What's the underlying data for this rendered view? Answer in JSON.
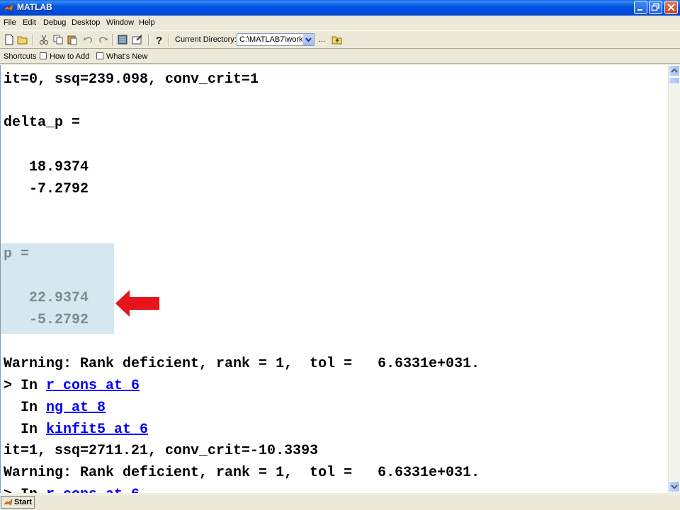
{
  "window": {
    "title": "MATLAB"
  },
  "menu": [
    "File",
    "Edit",
    "Debug",
    "Desktop",
    "Window",
    "Help"
  ],
  "toolbar": {
    "current_directory_label": "Current Directory:",
    "current_directory_value": "C:\\MATLAB7\\work",
    "browse_label": "..."
  },
  "shortcuts": {
    "label": "Shortcuts",
    "how_to_add": "How to Add",
    "whats_new": "What's New"
  },
  "console": {
    "lines": [
      "it=0, ssq=239.098, conv_crit=1",
      "delta_p =",
      "   18.9374",
      "   -7.2792",
      "p =",
      "   22.9374",
      "   -5.2792",
      "Warning: Rank deficient, rank = 1,  tol =   6.6331e+031.",
      "> In ",
      "  In ",
      "  In ",
      "it=1, ssq=2711.21, conv_crit=-10.3393",
      "Warning: Rank deficient, rank = 1,  tol =   6.6331e+031.",
      "> In "
    ],
    "links": [
      "r_cons at 6",
      "ng at 8",
      "kinfit5 at 6",
      "r_cons at 6"
    ]
  },
  "taskbar": {
    "start_label": "Start"
  },
  "colors": {
    "highlight": "#d6e8ef",
    "arrow": "#e8141c",
    "link": "#0000ff"
  }
}
